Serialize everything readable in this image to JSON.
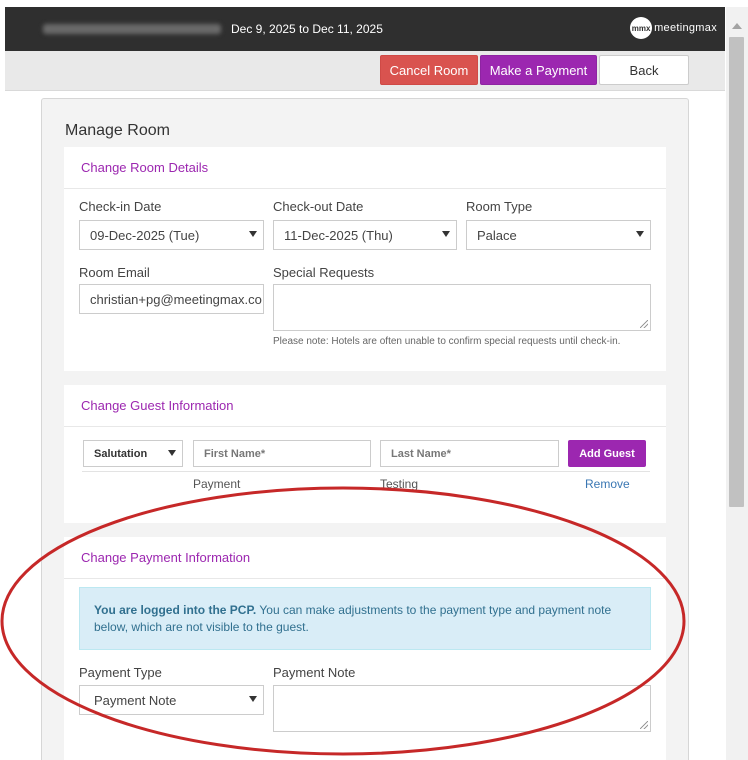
{
  "header": {
    "date_range": "Dec 9, 2025 to Dec 11, 2025",
    "logo_mark": "mmx",
    "logo_text": "meetingmax"
  },
  "actions": {
    "cancel_room": "Cancel Room",
    "make_payment": "Make a Payment",
    "back": "Back"
  },
  "page_title": "Manage Room",
  "room_details": {
    "heading": "Change Room Details",
    "checkin_label": "Check-in Date",
    "checkin_value": "09-Dec-2025 (Tue)",
    "checkout_label": "Check-out Date",
    "checkout_value": "11-Dec-2025 (Thu)",
    "room_type_label": "Room Type",
    "room_type_value": "Palace",
    "room_email_label": "Room Email",
    "room_email_value": "christian+pg@meetingmax.co",
    "special_requests_label": "Special Requests",
    "special_requests_value": "",
    "note": "Please note: Hotels are often unable to confirm special requests until check-in."
  },
  "guest_info": {
    "heading": "Change Guest Information",
    "salutation": "Salutation",
    "first_name_placeholder": "First Name*",
    "last_name_placeholder": "Last Name*",
    "add_guest": "Add Guest",
    "guests": [
      {
        "first_name": "Payment",
        "last_name": "Testing",
        "action": "Remove"
      }
    ]
  },
  "payment_info": {
    "heading": "Change Payment Information",
    "alert_bold": "You are logged into the PCP.",
    "alert_text": " You can make adjustments to the payment type and payment note below, which are not visible to the guest.",
    "payment_type_label": "Payment Type",
    "payment_type_value": "Payment Note",
    "payment_note_label": "Payment Note",
    "payment_note_value": ""
  },
  "colors": {
    "accent": "#9c27b0",
    "danger": "#d9534f",
    "header_bg": "#2f2f2f",
    "annotation": "#c62828"
  }
}
